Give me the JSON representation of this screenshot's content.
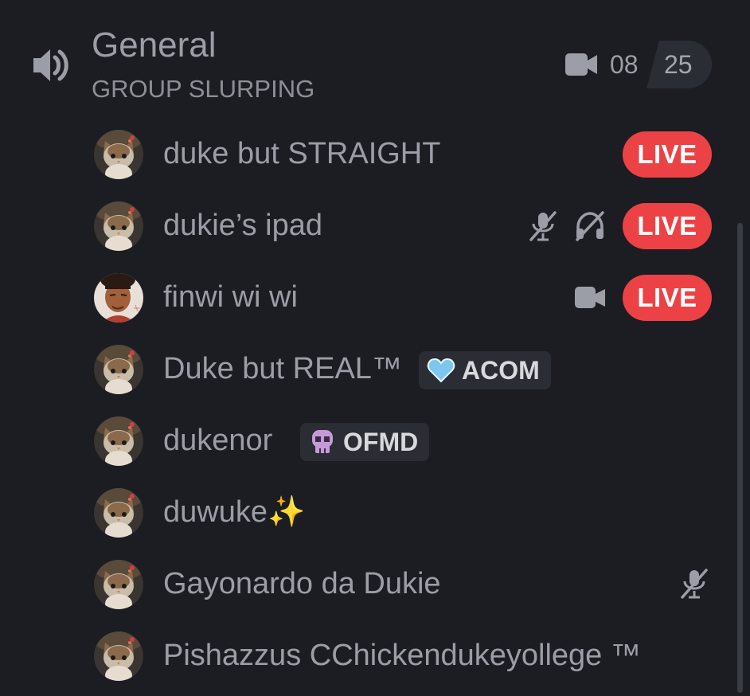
{
  "channel": {
    "name": "General",
    "topic": "GROUP SLURPING",
    "video_count": "08",
    "user_limit": "25"
  },
  "members": [
    {
      "name": "duke but STRAIGHT",
      "live_label": "LIVE"
    },
    {
      "name": "dukie’s ipad",
      "live_label": "LIVE"
    },
    {
      "name": "finwi wi wi",
      "live_label": "LIVE"
    },
    {
      "name": "Duke but REAL™",
      "role": "ACOM"
    },
    {
      "name": "dukenor",
      "role": "OFMD"
    },
    {
      "name": "duwuke✨"
    },
    {
      "name": "Gayonardo da Dukie"
    },
    {
      "name": "Pishazzus CChickendukeyollege ™"
    }
  ],
  "colors": {
    "background": "#1c1d23",
    "text": "#9b9ea6",
    "live": "#ed4245",
    "pill": "#2b2d34",
    "heart": "#7cc6f0",
    "skull": "#c69ad8"
  }
}
